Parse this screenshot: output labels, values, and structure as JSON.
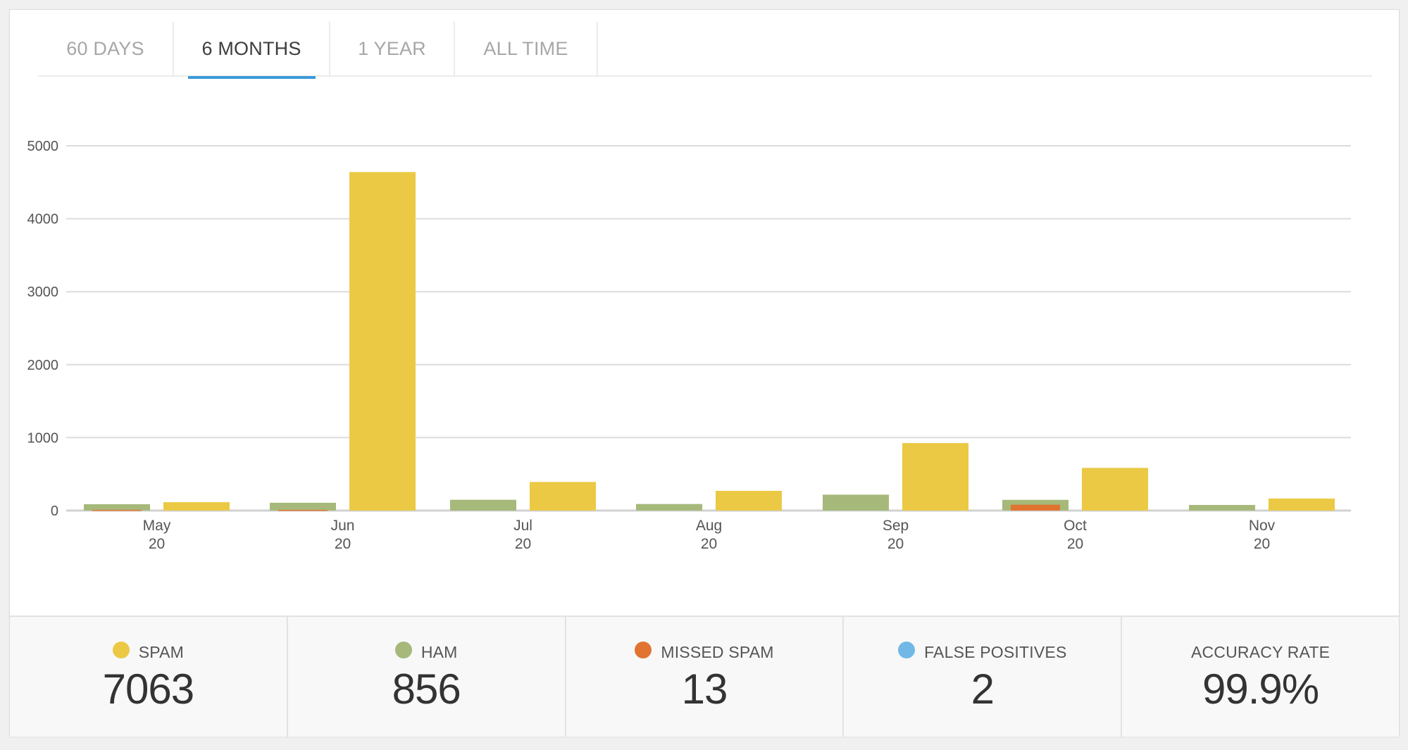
{
  "tabs": [
    {
      "label": "60 DAYS",
      "active": false
    },
    {
      "label": "6 MONTHS",
      "active": true
    },
    {
      "label": "1 YEAR",
      "active": false
    },
    {
      "label": "ALL TIME",
      "active": false
    }
  ],
  "colors": {
    "spam": "#ebc944",
    "ham": "#a6b97a",
    "missed_spam": "#e07430",
    "false_positives": "#72b8e6",
    "active_tab": "#3b9ad9",
    "grid": "#dcdcdc"
  },
  "chart_data": {
    "type": "bar",
    "title": "",
    "xlabel": "",
    "ylabel": "",
    "ylim": [
      0,
      5000
    ],
    "yticks": [
      0,
      1000,
      2000,
      3000,
      4000,
      5000
    ],
    "grid": true,
    "legend": "bottom",
    "categories": [
      {
        "month": "May",
        "year": "20"
      },
      {
        "month": "Jun",
        "year": "20"
      },
      {
        "month": "Jul",
        "year": "20"
      },
      {
        "month": "Aug",
        "year": "20"
      },
      {
        "month": "Sep",
        "year": "20"
      },
      {
        "month": "Oct",
        "year": "20"
      },
      {
        "month": "Nov",
        "year": "20"
      }
    ],
    "series": [
      {
        "name": "Ham",
        "color_key": "ham",
        "values": [
          87,
          107,
          148,
          90,
          218,
          147,
          77
        ]
      },
      {
        "name": "Missed Spam",
        "color_key": "missed_spam",
        "values": [
          10,
          10,
          0,
          0,
          0,
          80,
          0
        ]
      },
      {
        "name": "Spam",
        "color_key": "spam",
        "values": [
          115,
          4640,
          392,
          270,
          925,
          585,
          165
        ]
      }
    ]
  },
  "stats": [
    {
      "label": "SPAM",
      "value": "7063",
      "dot": "spam"
    },
    {
      "label": "HAM",
      "value": "856",
      "dot": "ham"
    },
    {
      "label": "MISSED SPAM",
      "value": "13",
      "dot": "missed_spam"
    },
    {
      "label": "FALSE POSITIVES",
      "value": "2",
      "dot": "false_positives"
    },
    {
      "label": "ACCURACY RATE",
      "value": "99.9%",
      "dot": null
    }
  ]
}
